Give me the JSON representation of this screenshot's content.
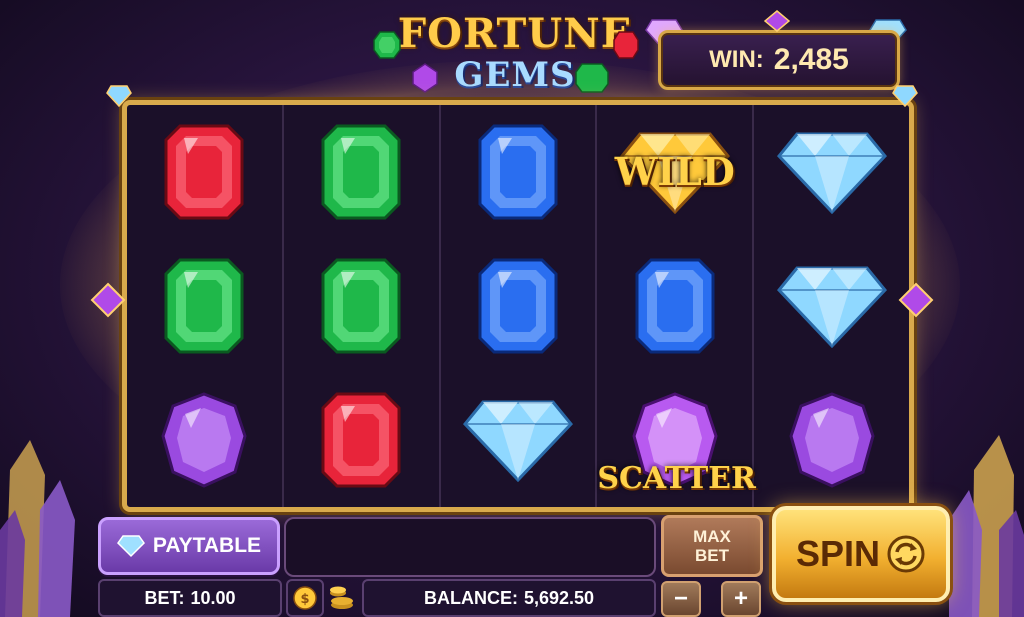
{
  "title": {
    "line1": "FORTUNE",
    "line2": "GEMS"
  },
  "win": {
    "label": "WIN:",
    "value": "2,485"
  },
  "reels": [
    [
      "red-emerald-gem",
      "green-emerald-gem",
      "purple-oval-gem"
    ],
    [
      "green-emerald-gem",
      "green-emerald-gem",
      "red-emerald-gem"
    ],
    [
      "blue-emerald-gem",
      "blue-emerald-gem",
      "cyan-diamond-gem"
    ],
    [
      "wild-gold-diamond",
      "blue-emerald-gem",
      "scatter-purple-gem"
    ],
    [
      "cyan-diamond-gem",
      "cyan-diamond-gem",
      "purple-oval-gem"
    ]
  ],
  "symbols": {
    "wild_label": "WILD",
    "scatter_label": "SCATTER"
  },
  "controls": {
    "paytable_label": "PAYTABLE",
    "maxbet_line1": "MAX",
    "maxbet_line2": "BET",
    "spin_label": "SPIN",
    "bet_label": "BET:",
    "bet_value": "10.00",
    "balance_label": "BALANCE:",
    "balance_value": "5,692.50",
    "minus_label": "−",
    "plus_label": "+"
  },
  "colors": {
    "red": "#e8243a",
    "green": "#1fb84a",
    "blue": "#2a6ef0",
    "cyan": "#8fd8ff",
    "purple": "#9a4ae0",
    "gold": "#ffc93a",
    "frame": "#d9aa4c"
  }
}
